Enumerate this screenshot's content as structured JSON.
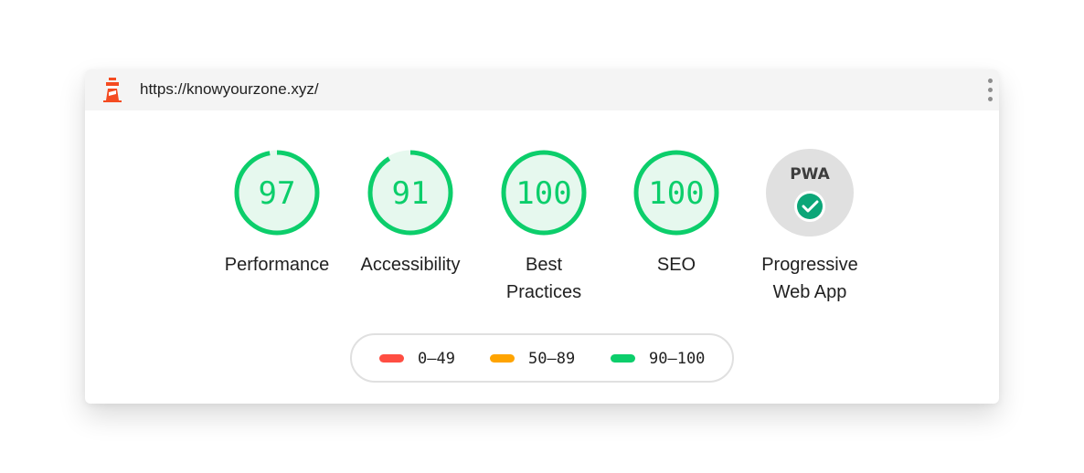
{
  "header": {
    "url": "https://knowyourzone.xyz/",
    "logo_icon": "lighthouse-icon",
    "menu_icon": "kebab-menu-icon"
  },
  "gauges": [
    {
      "score": "97",
      "label_line1": "Performance",
      "label_line2": "",
      "value": 0.97,
      "color": "#0cce6b"
    },
    {
      "score": "91",
      "label_line1": "Accessibility",
      "label_line2": "",
      "value": 0.91,
      "color": "#0cce6b"
    },
    {
      "score": "100",
      "label_line1": "Best",
      "label_line2": "Practices",
      "value": 1.0,
      "color": "#0cce6b"
    },
    {
      "score": "100",
      "label_line1": "SEO",
      "label_line2": "",
      "value": 1.0,
      "color": "#0cce6b"
    }
  ],
  "pwa": {
    "badge_text": "PWA",
    "label_line1": "Progressive",
    "label_line2": "Web App",
    "status_icon": "check-circle-icon"
  },
  "legend": [
    {
      "range": "0–49",
      "color": "#ff4e42"
    },
    {
      "range": "50–89",
      "color": "#ffa400"
    },
    {
      "range": "90–100",
      "color": "#0cce6b"
    }
  ]
}
